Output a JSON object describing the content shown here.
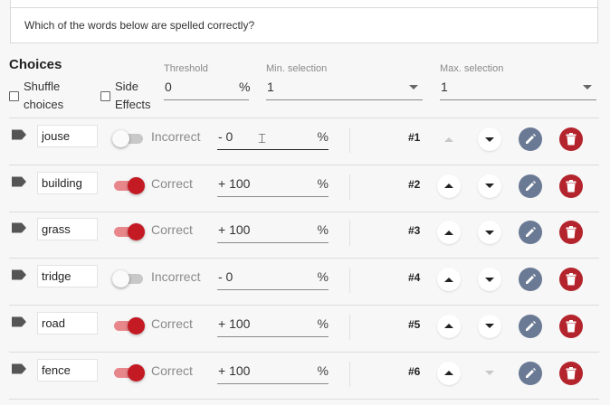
{
  "question": {
    "text": "Which of the words below are spelled correctly?"
  },
  "choices_header": {
    "title": "Choices",
    "shuffle_label": "Shuffle\nchoices",
    "side_effects_label": "Side\nEffects",
    "threshold": {
      "label": "Threshold",
      "value": "0",
      "unit": "%"
    },
    "min_selection": {
      "label": "Min. selection",
      "value": "1"
    },
    "max_selection": {
      "label": "Max. selection",
      "value": "1"
    }
  },
  "choices": [
    {
      "word": "jouse",
      "correct": false,
      "status": "Incorrect",
      "score": "- 0",
      "unit": "%",
      "number": "#1",
      "can_move_up": false,
      "can_move_down": true
    },
    {
      "word": "building",
      "correct": true,
      "status": "Correct",
      "score": "+ 100",
      "unit": "%",
      "number": "#2",
      "can_move_up": true,
      "can_move_down": true
    },
    {
      "word": "grass",
      "correct": true,
      "status": "Correct",
      "score": "+ 100",
      "unit": "%",
      "number": "#3",
      "can_move_up": true,
      "can_move_down": true
    },
    {
      "word": "tridge",
      "correct": false,
      "status": "Incorrect",
      "score": "- 0",
      "unit": "%",
      "number": "#4",
      "can_move_up": true,
      "can_move_down": true
    },
    {
      "word": "road",
      "correct": true,
      "status": "Correct",
      "score": "+ 100",
      "unit": "%",
      "number": "#5",
      "can_move_up": true,
      "can_move_down": true
    },
    {
      "word": "fence",
      "correct": true,
      "status": "Correct",
      "score": "+ 100",
      "unit": "%",
      "number": "#6",
      "can_move_up": true,
      "can_move_down": false
    }
  ],
  "icons": {
    "tag": "tag-icon",
    "edit": "pencil-icon",
    "delete": "trash-icon",
    "up": "arrow-up-icon",
    "down": "arrow-down-icon"
  },
  "colors": {
    "accent_red": "#c41a24",
    "edit_button": "#6a7a95",
    "delete_button": "#b3242c"
  }
}
